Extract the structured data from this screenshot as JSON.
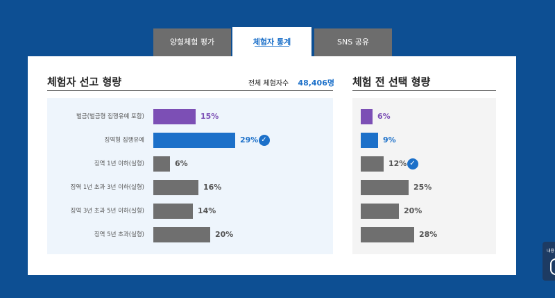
{
  "tabs": [
    {
      "label": "양형체험 평가"
    },
    {
      "label": "체험자 통계"
    },
    {
      "label": "SNS 공유"
    }
  ],
  "left": {
    "title": "체험자 선고 형량",
    "total_label": "전체 체험자수",
    "total_value": "48,406명",
    "rows": [
      {
        "label": "벌금(벌금형 집행유예 포함)",
        "pct": "15%",
        "value": 15,
        "color": "#7c4fb5",
        "selected": false
      },
      {
        "label": "징역형 집행유예",
        "pct": "29%",
        "value": 29,
        "color": "#1c70c9",
        "selected": true
      },
      {
        "label": "징역 1년 이하(실형)",
        "pct": "6%",
        "value": 6,
        "color": "#6f6f6f",
        "selected": false
      },
      {
        "label": "징역 1년 초과 3년 이하(실형)",
        "pct": "16%",
        "value": 16,
        "color": "#6f6f6f",
        "selected": false
      },
      {
        "label": "징역 3년 초과 5년 이하(실형)",
        "pct": "14%",
        "value": 14,
        "color": "#6f6f6f",
        "selected": false
      },
      {
        "label": "징역 5년 초과(실형)",
        "pct": "20%",
        "value": 20,
        "color": "#6f6f6f",
        "selected": false
      }
    ]
  },
  "right": {
    "title": "체험 전 선택 형량",
    "rows": [
      {
        "pct": "6%",
        "value": 6,
        "color": "#7c4fb5",
        "selected": false
      },
      {
        "pct": "9%",
        "value": 9,
        "color": "#1c70c9",
        "selected": false
      },
      {
        "pct": "12%",
        "value": 12,
        "color": "#6f6f6f",
        "selected": true
      },
      {
        "pct": "25%",
        "value": 25,
        "color": "#6f6f6f",
        "selected": false
      },
      {
        "pct": "20%",
        "value": 20,
        "color": "#6f6f6f",
        "selected": false
      },
      {
        "pct": "28%",
        "value": 28,
        "color": "#6f6f6f",
        "selected": false
      }
    ]
  },
  "side_widget": {
    "label": "내용"
  }
}
